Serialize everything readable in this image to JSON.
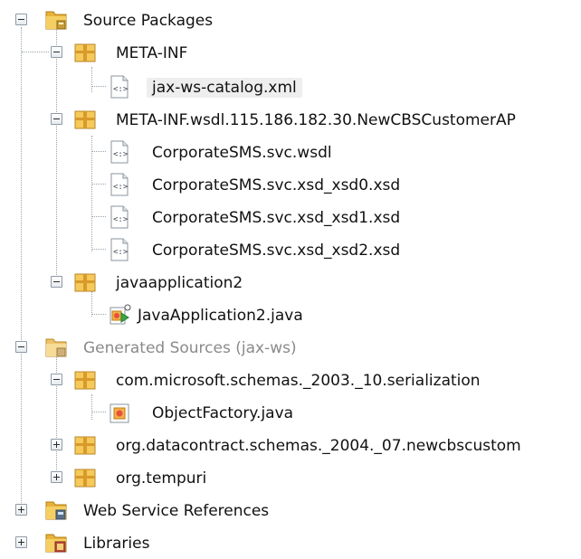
{
  "tree": {
    "source_packages": "Source Packages",
    "meta_inf": "META-INF",
    "jax_ws_catalog": "jax-ws-catalog.xml",
    "meta_inf_wsdl": "META-INF.wsdl.115.186.182.30.NewCBSCustomerAP",
    "wsdl_files": [
      "CorporateSMS.svc.wsdl",
      "CorporateSMS.svc.xsd_xsd0.xsd",
      "CorporateSMS.svc.xsd_xsd1.xsd",
      "CorporateSMS.svc.xsd_xsd2.xsd"
    ],
    "javaapplication2": "javaapplication2",
    "javaapplication2_java": "JavaApplication2.java",
    "generated_sources": "Generated Sources (jax-ws)",
    "com_microsoft": "com.microsoft.schemas._2003._10.serialization",
    "object_factory": "ObjectFactory.java",
    "org_datacontract": "org.datacontract.schemas._2004._07.newcbscustom",
    "org_tempuri": "org.tempuri",
    "web_service_references": "Web Service References",
    "libraries": "Libraries"
  }
}
